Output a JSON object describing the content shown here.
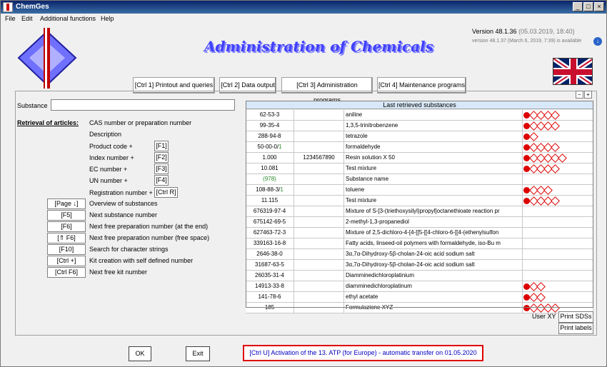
{
  "window": {
    "title": "ChemGes"
  },
  "menu": [
    "File",
    "Edit",
    "Additional functions",
    "Help"
  ],
  "header": {
    "title": "Administration of Chemicals",
    "version": "Version 48.1.36",
    "version_date": "(05.03.2019, 18:40)",
    "version_available": "version 48.1.37 (March 6, 2019, 7:39) is available"
  },
  "tabs": [
    "[Ctrl 1] Printout and queries",
    "[Ctrl 2] Data output",
    "[Ctrl 3] Administration programs",
    "[Ctrl 4] Maintenance programs"
  ],
  "left": {
    "substance_label": "Substance",
    "retrieval_label": "Retrieval of articles:",
    "fields": [
      {
        "label": "CAS number or preparation number",
        "key": ""
      },
      {
        "label": "Description",
        "key": ""
      },
      {
        "label": "Product code +",
        "key": "[F1]"
      },
      {
        "label": "Index number +",
        "key": "[F2]"
      },
      {
        "label": "EC number +",
        "key": "[F3]"
      },
      {
        "label": "UN number +",
        "key": "[F4]"
      },
      {
        "label": "Registration number +",
        "key": "[Ctrl R]"
      }
    ],
    "actions": [
      {
        "key": "[Page ↓]",
        "label": "Overview of substances"
      },
      {
        "key": "[F5]",
        "label": "Next substance number"
      },
      {
        "key": "[F6]",
        "label": "Next free preparation number (at the end)"
      },
      {
        "key": "[⇑ F6]",
        "label": "Next free preparation number (free space)"
      },
      {
        "key": "[F10]",
        "label": "Search for character strings"
      },
      {
        "key": "[Ctrl +]",
        "label": "Kit creation with self defined number"
      },
      {
        "key": "[Ctrl F6]",
        "label": "Next free kit number"
      }
    ]
  },
  "table": {
    "header": "Last retrieved substances",
    "rows": [
      {
        "num": "62-53-3",
        "code": "",
        "name": "aniline",
        "haz": 5
      },
      {
        "num": "99-35-4",
        "code": "",
        "name": "1,3,5-trinitrobenzene",
        "haz": 5
      },
      {
        "num": "288-94-8",
        "code": "",
        "name": "tetrazole",
        "haz": 2
      },
      {
        "num": "50-00-0/",
        "num_suffix": "1",
        "code": "",
        "name": "formaldehyde",
        "haz": 5
      },
      {
        "num": "1.000",
        "code": "1234567890",
        "name": "Resin solution X 50",
        "haz": 6
      },
      {
        "num": "10.081",
        "code": "",
        "name": "Test mixture",
        "haz": 5
      },
      {
        "num": "(978)",
        "code": "",
        "name": "Substance name",
        "haz": 0
      },
      {
        "num": "108-88-3/",
        "num_suffix": "1",
        "code": "",
        "name": "toluene",
        "haz": 4
      },
      {
        "num": "11.115",
        "code": "",
        "name": "Test mixture",
        "haz": 5
      },
      {
        "num": "676319-97-4",
        "code": "",
        "name": "Mixture of S-[3-(triethoxysilyl)propyl]octanethioate reaction pr",
        "haz": 0
      },
      {
        "num": "675142-69-5",
        "code": "",
        "name": "2-methyl-1,3-propanediol",
        "haz": 0
      },
      {
        "num": "627463-72-3",
        "code": "",
        "name": "Mixture of 2,5-dichloro-4-[4-[[5-[[4-chloro-6-[[4-(ethenylsulfon",
        "haz": 0
      },
      {
        "num": "339163-16-8",
        "code": "",
        "name": "Fatty acids, linseed-oil polymers with formaldehyde, iso-Bu m",
        "haz": 0
      },
      {
        "num": "2646-38-0",
        "code": "",
        "name": "3α,7α-Dihydroxy-5β-cholan-24-oic acid sodium salt",
        "haz": 0
      },
      {
        "num": "31687-63-5",
        "code": "",
        "name": "3α,7α-Dihydroxy-5β-cholan-24-oic acid sodium salt",
        "haz": 0
      },
      {
        "num": "26035-31-4",
        "code": "",
        "name": "Diamminedichloroplatinium",
        "haz": 0
      },
      {
        "num": "14913-33-8",
        "code": "",
        "name": "diamminedichloroplatinum",
        "haz": 3
      },
      {
        "num": "141-78-6",
        "code": "",
        "name": "ethyl acetate",
        "haz": 3
      },
      {
        "num": "185",
        "code": "",
        "name": "Formulazione XYZ",
        "haz": 5
      }
    ]
  },
  "right": {
    "user": "User XY",
    "print_sds": "Print SDSs",
    "print_labels": "Print labels"
  },
  "footer": {
    "ok": "OK",
    "exit": "Exit",
    "activation": "[Ctrl U] Activation of the 13. ATP (for Europe) - automatic transfer on 01.05.2020"
  }
}
